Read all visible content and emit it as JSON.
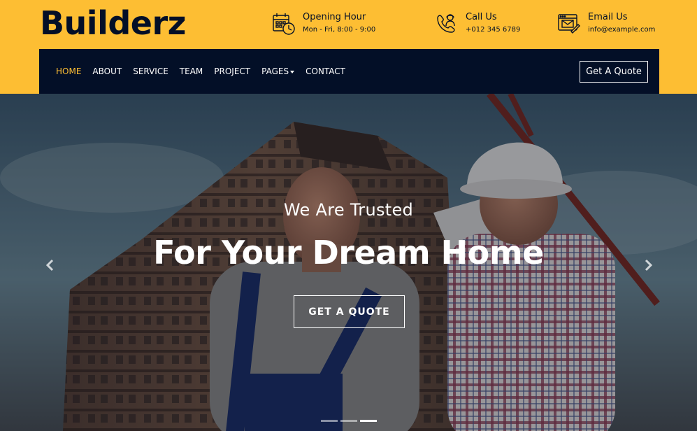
{
  "brand": {
    "name": "Builderz"
  },
  "colors": {
    "accent": "#FDBE33",
    "dark": "#030F27",
    "white": "#FFFFFF"
  },
  "top_info": [
    {
      "icon": "calendar-clock-icon",
      "title": "Opening Hour",
      "detail": "Mon - Fri, 8:00 - 9:00"
    },
    {
      "icon": "call-support-icon",
      "title": "Call Us",
      "detail": "+012 345 6789"
    },
    {
      "icon": "email-browser-icon",
      "title": "Email Us",
      "detail": "info@example.com"
    }
  ],
  "nav": {
    "items": [
      {
        "label": "HOME",
        "active": true
      },
      {
        "label": "ABOUT",
        "active": false
      },
      {
        "label": "SERVICE",
        "active": false
      },
      {
        "label": "TEAM",
        "active": false
      },
      {
        "label": "PROJECT",
        "active": false
      },
      {
        "label": "PAGES",
        "active": false,
        "dropdown": true
      },
      {
        "label": "CONTACT",
        "active": false
      }
    ],
    "cta_label": "Get A Quote"
  },
  "hero": {
    "subtitle": "We Are Trusted",
    "title": "For Your Dream Home",
    "button_label": "GET A QUOTE",
    "prev_icon": "chevron-left-icon",
    "next_icon": "chevron-right-icon",
    "slides_count": 3,
    "active_slide": 3
  }
}
